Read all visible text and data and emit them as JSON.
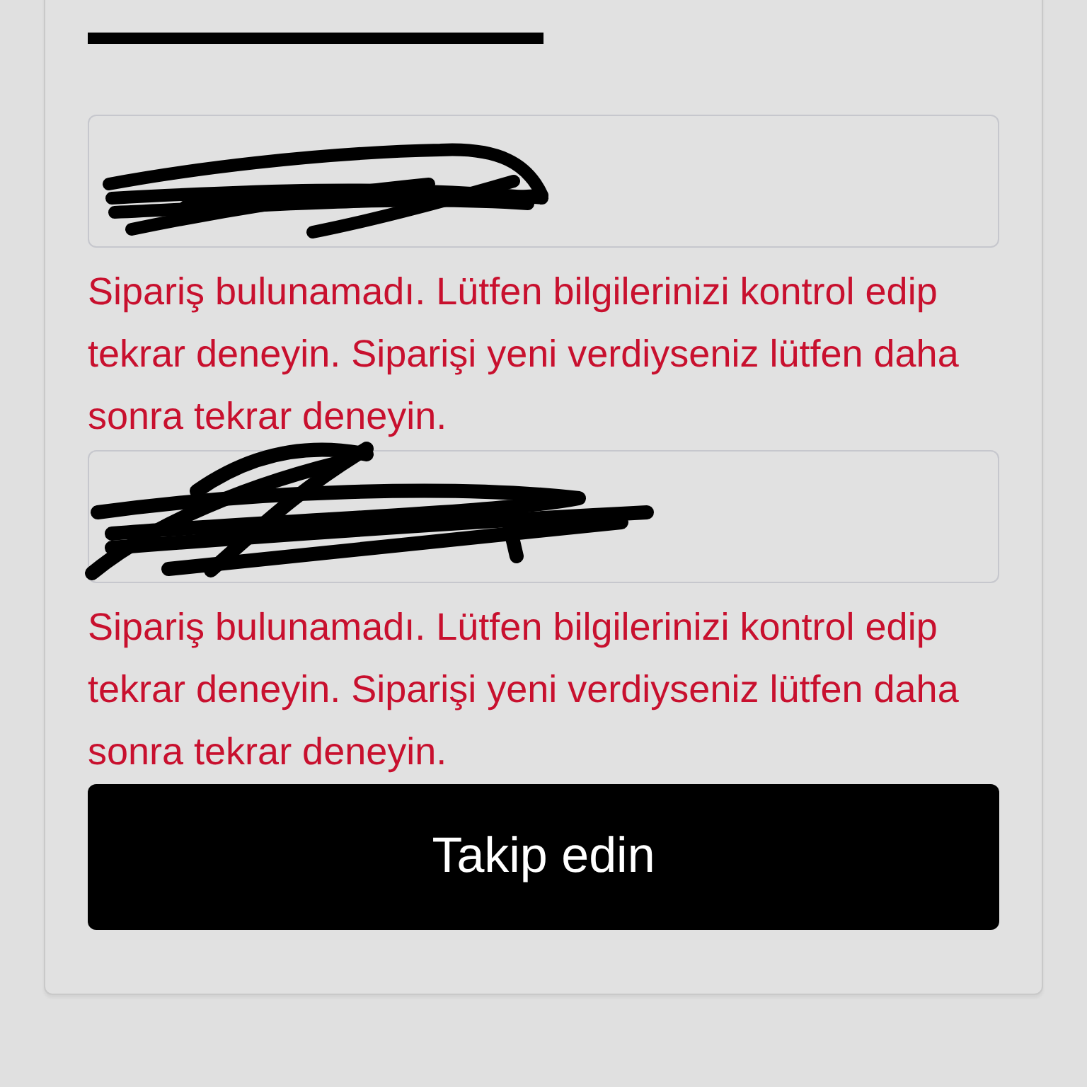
{
  "tabs": [
    {
      "selected": true
    },
    {
      "selected": false
    }
  ],
  "fields": [
    {
      "redacted": true,
      "error": "Sipariş bulunamadı. Lütfen bilgilerinizi kontrol edip tekrar deneyin. Siparişi yeni verdiyseniz lütfen daha sonra tekrar deneyin."
    },
    {
      "redacted": true,
      "error": "Sipariş bulunamadı. Lütfen bilgilerinizi kontrol edip tekrar deneyin. Siparişi yeni verdiyseniz lütfen daha sonra tekrar deneyin."
    }
  ],
  "submit_button": {
    "label": "Takip edin"
  }
}
